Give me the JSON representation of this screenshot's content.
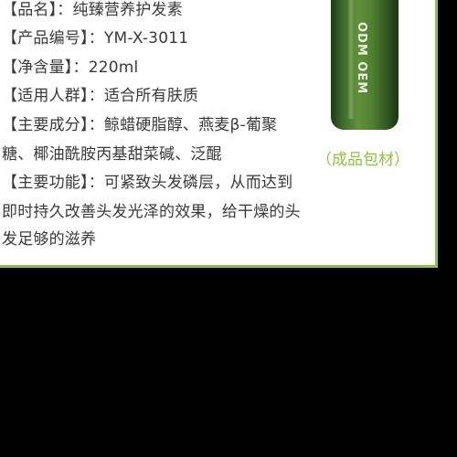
{
  "lines": [
    "【品名】：纯臻营养护发素",
    "【产品编号】：YM-X-3011",
    "【净含量】：220ml",
    "【适用人群】：适合所有肤质",
    "【主要成分】：鲸蜡硬脂醇、燕麦β-葡聚",
    "糖、椰油酰胺丙基甜菜碱、泛醌",
    "【主要功能】：可紧致头发磷层，从而达到",
    "即时持久改善头发光泽的效果，给干燥的头",
    "发足够的滋养"
  ],
  "bottle_label": "ODM OEM",
  "caption": "（成品包材）",
  "colors": {
    "accent_green": "#8cc63f",
    "bottle_green": "#4f7f30",
    "text": "#3a3a3a",
    "background": "#000000"
  }
}
